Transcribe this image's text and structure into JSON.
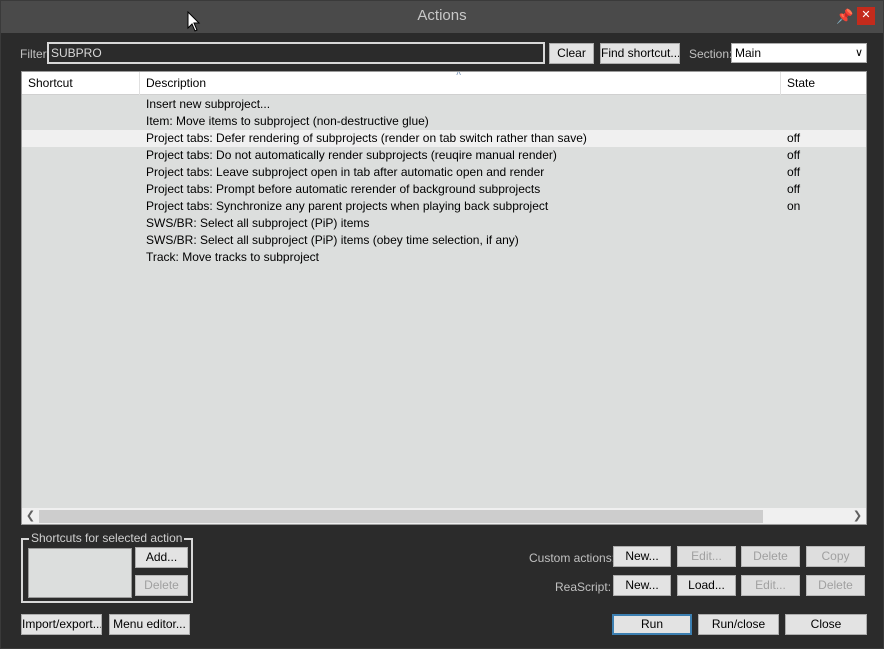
{
  "window": {
    "title": "Actions"
  },
  "filter": {
    "label": "Filter:",
    "value": "SUBPRO",
    "clear_label": "Clear",
    "find_shortcut_label": "Find shortcut..."
  },
  "section": {
    "label": "Section:",
    "selected": "Main"
  },
  "list": {
    "columns": [
      "Shortcut",
      "Description",
      "State"
    ],
    "rows": [
      {
        "shortcut": "",
        "description": "Insert new subproject...",
        "state": "",
        "selected": false
      },
      {
        "shortcut": "",
        "description": "Item: Move items to subproject (non-destructive glue)",
        "state": "",
        "selected": false
      },
      {
        "shortcut": "",
        "description": "Project tabs: Defer rendering of subprojects (render on tab switch rather than save)",
        "state": "off",
        "selected": true
      },
      {
        "shortcut": "",
        "description": "Project tabs: Do not automatically render subprojects (reuqire manual render)",
        "state": "off",
        "selected": false
      },
      {
        "shortcut": "",
        "description": "Project tabs: Leave subproject open in tab after automatic open and render",
        "state": "off",
        "selected": false
      },
      {
        "shortcut": "",
        "description": "Project tabs: Prompt before automatic rerender of background subprojects",
        "state": "off",
        "selected": false
      },
      {
        "shortcut": "",
        "description": "Project tabs: Synchronize any parent projects when playing back subproject",
        "state": "on",
        "selected": false
      },
      {
        "shortcut": "",
        "description": "SWS/BR: Select all subproject (PiP) items",
        "state": "",
        "selected": false
      },
      {
        "shortcut": "",
        "description": "SWS/BR: Select all subproject (PiP) items (obey time selection, if any)",
        "state": "",
        "selected": false
      },
      {
        "shortcut": "",
        "description": "Track: Move tracks to subproject",
        "state": "",
        "selected": false
      }
    ]
  },
  "shortcuts_group": {
    "label": "Shortcuts for selected action",
    "add_label": "Add...",
    "delete_label": "Delete"
  },
  "custom_actions": {
    "label": "Custom actions:",
    "new_label": "New...",
    "edit_label": "Edit...",
    "delete_label": "Delete",
    "copy_label": "Copy"
  },
  "reascript": {
    "label": "ReaScript:",
    "new_label": "New...",
    "load_label": "Load...",
    "edit_label": "Edit...",
    "delete_label": "Delete"
  },
  "bottom": {
    "import_export_label": "Import/export...",
    "menu_editor_label": "Menu editor...",
    "run_label": "Run",
    "run_close_label": "Run/close",
    "close_label": "Close"
  },
  "icons": {
    "pin": "pin-icon",
    "close": "close-icon",
    "dropdown": "chevron-down-icon",
    "scroll_left": "chevron-left-icon",
    "scroll_right": "chevron-right-icon",
    "sort": "sort-ascending-icon"
  }
}
